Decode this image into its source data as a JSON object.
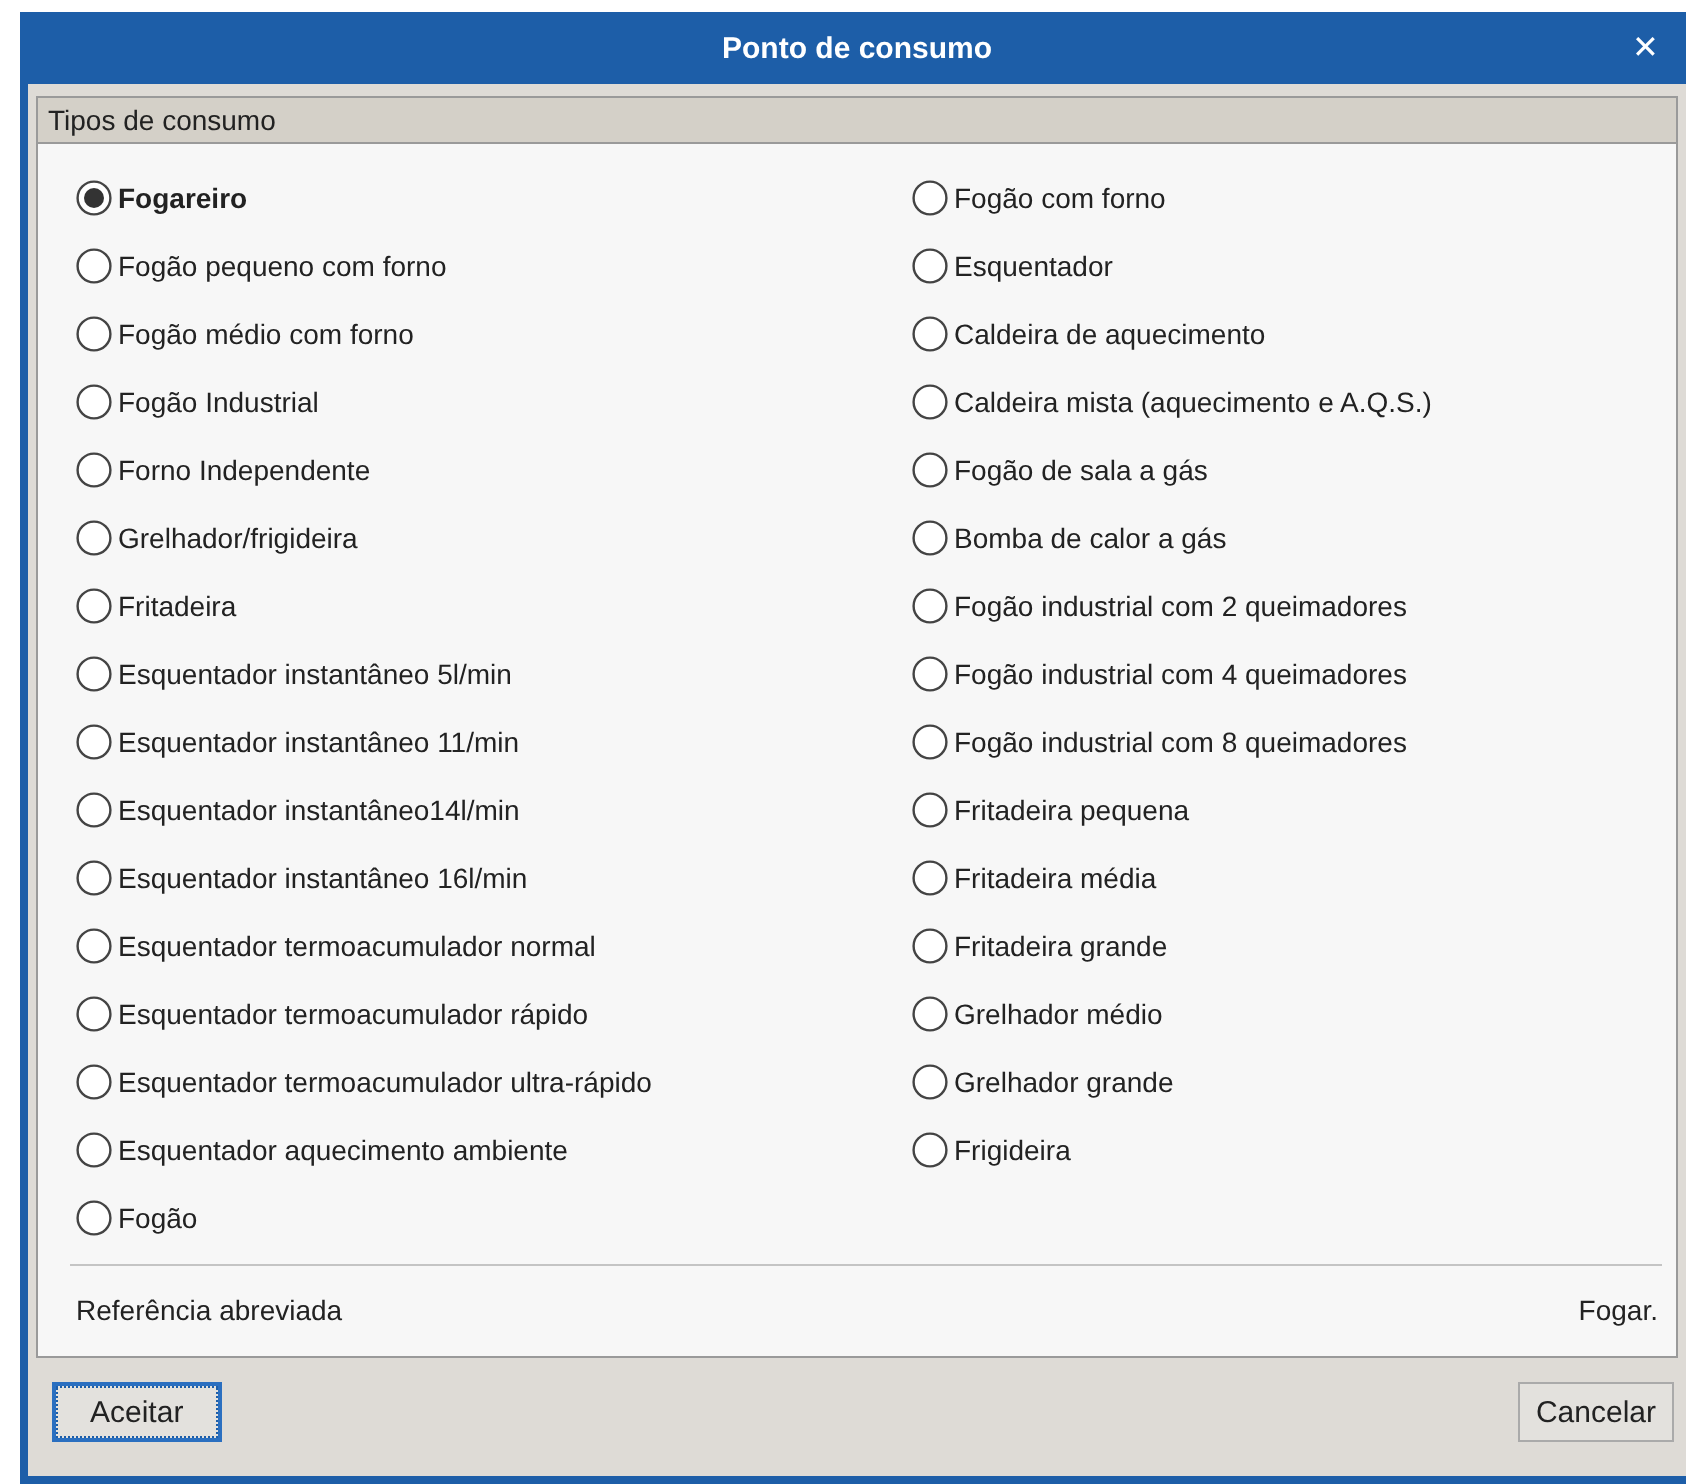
{
  "window": {
    "title": "Ponto de consumo",
    "close": "✕"
  },
  "group": {
    "title": "Tipos de consumo",
    "columns": [
      [
        {
          "label": "Fogareiro",
          "selected": true
        },
        {
          "label": "Fogão pequeno com forno",
          "selected": false
        },
        {
          "label": "Fogão médio com forno",
          "selected": false
        },
        {
          "label": "Fogão Industrial",
          "selected": false
        },
        {
          "label": "Forno Independente",
          "selected": false
        },
        {
          "label": "Grelhador/frigideira",
          "selected": false
        },
        {
          "label": "Fritadeira",
          "selected": false
        },
        {
          "label": "Esquentador instantâneo 5l/min",
          "selected": false
        },
        {
          "label": "Esquentador instantâneo 11/min",
          "selected": false
        },
        {
          "label": "Esquentador instantâneo14l/min",
          "selected": false
        },
        {
          "label": "Esquentador instantâneo 16l/min",
          "selected": false
        },
        {
          "label": "Esquentador termoacumulador normal",
          "selected": false
        },
        {
          "label": "Esquentador termoacumulador rápido",
          "selected": false
        },
        {
          "label": "Esquentador termoacumulador ultra-rápido",
          "selected": false
        },
        {
          "label": "Esquentador aquecimento ambiente",
          "selected": false
        },
        {
          "label": "Fogão",
          "selected": false
        }
      ],
      [
        {
          "label": "Fogão com forno",
          "selected": false
        },
        {
          "label": "Esquentador",
          "selected": false
        },
        {
          "label": "Caldeira de aquecimento",
          "selected": false
        },
        {
          "label": "Caldeira mista (aquecimento e A.Q.S.)",
          "selected": false
        },
        {
          "label": "Fogão de sala a gás",
          "selected": false
        },
        {
          "label": "Bomba de calor a gás",
          "selected": false
        },
        {
          "label": "Fogão industrial com 2 queimadores",
          "selected": false
        },
        {
          "label": "Fogão industrial com 4 queimadores",
          "selected": false
        },
        {
          "label": "Fogão industrial com 8 queimadores",
          "selected": false
        },
        {
          "label": "Fritadeira pequena",
          "selected": false
        },
        {
          "label": "Fritadeira média",
          "selected": false
        },
        {
          "label": "Fritadeira grande",
          "selected": false
        },
        {
          "label": "Grelhador médio",
          "selected": false
        },
        {
          "label": "Grelhador grande",
          "selected": false
        },
        {
          "label": "Frigideira",
          "selected": false
        }
      ]
    ],
    "reference": {
      "label": "Referência abreviada",
      "value": "Fogar."
    }
  },
  "buttons": [
    {
      "label": "Aceitar",
      "focused": true
    },
    {
      "label": "Cancelar",
      "focused": false
    }
  ]
}
